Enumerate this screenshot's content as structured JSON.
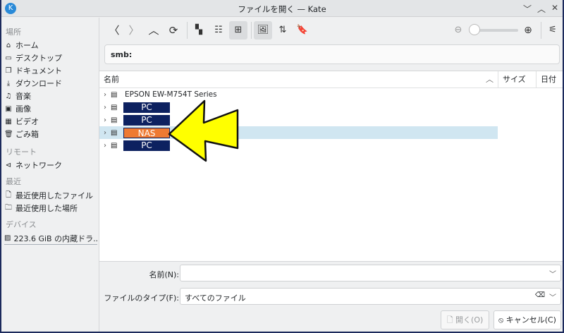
{
  "window": {
    "title": "ファイルを開く — Kate",
    "minimize": "﹀",
    "maximize": "︿",
    "close": "✕"
  },
  "sidebar": {
    "sections": [
      {
        "label": "場所",
        "items": [
          {
            "label": "ホーム",
            "icon": "home-icon"
          },
          {
            "label": "デスクトップ",
            "icon": "desktop-icon"
          },
          {
            "label": "ドキュメント",
            "icon": "documents-icon"
          },
          {
            "label": "ダウンロード",
            "icon": "download-icon"
          },
          {
            "label": "音楽",
            "icon": "music-icon"
          },
          {
            "label": "画像",
            "icon": "image-icon"
          },
          {
            "label": "ビデオ",
            "icon": "video-icon"
          },
          {
            "label": "ごみ箱",
            "icon": "trash-icon"
          }
        ]
      },
      {
        "label": "リモート",
        "items": [
          {
            "label": "ネットワーク",
            "icon": "network-icon"
          }
        ]
      },
      {
        "label": "最近",
        "items": [
          {
            "label": "最近使用したファイル",
            "icon": "recent-files-icon"
          },
          {
            "label": "最近使用した場所",
            "icon": "recent-places-icon"
          }
        ]
      },
      {
        "label": "デバイス",
        "items": [
          {
            "label": "223.6 GiB の内蔵ドラ...",
            "icon": "drive-icon"
          }
        ]
      }
    ]
  },
  "location": {
    "value": "smb:"
  },
  "columns": {
    "name": "名前",
    "size": "サイズ",
    "date": "日付"
  },
  "rows": [
    {
      "label": "EPSON EW-M754T Series",
      "redacted": false
    },
    {
      "label": "PC",
      "redacted": true,
      "color": "#0d2160"
    },
    {
      "label": "PC",
      "redacted": true,
      "color": "#0d2160"
    },
    {
      "label": "NAS",
      "redacted": true,
      "color": "#ee7a32",
      "selected": true
    },
    {
      "label": "PC",
      "redacted": true,
      "color": "#0d2160"
    }
  ],
  "form": {
    "name_label": "名前(N):",
    "name_value": "",
    "type_label": "ファイルのタイプ(F):",
    "type_value": "すべてのファイル"
  },
  "buttons": {
    "open": "開く(O)",
    "cancel": "キャンセル(C)"
  },
  "zoom_level": 0,
  "colors": {
    "arrow": "#ffff00",
    "selection": "#d0e6f1"
  }
}
